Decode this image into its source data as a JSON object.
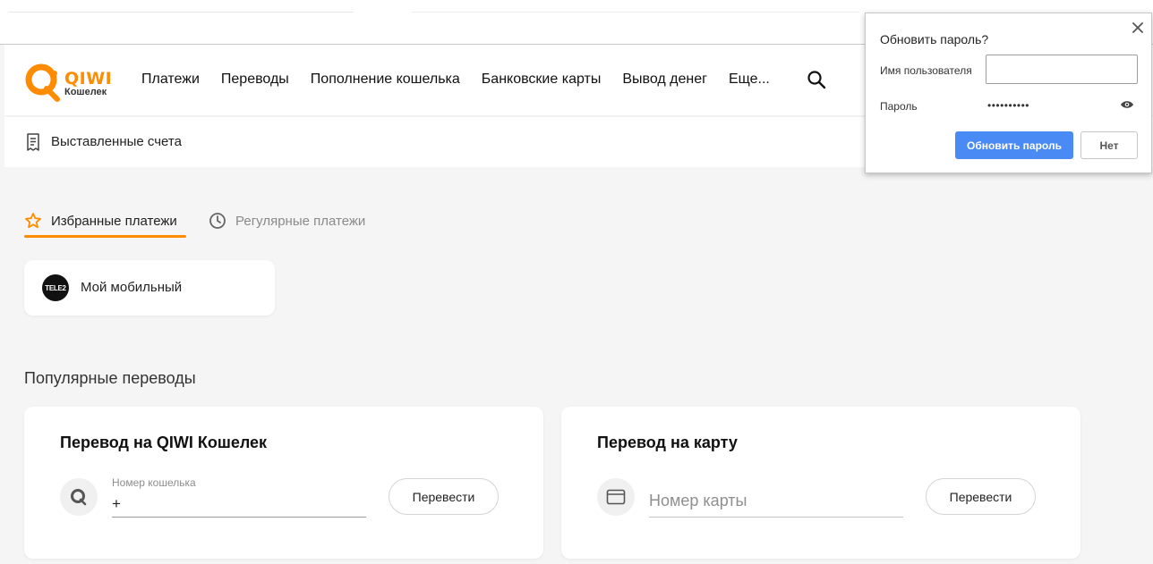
{
  "brand": {
    "name": "QIWI",
    "sub": "Кошелек",
    "accent": "#ff8c00"
  },
  "nav": {
    "items": [
      "Платежи",
      "Переводы",
      "Пополнение кошелька",
      "Банковские карты",
      "Вывод денег",
      "Еще..."
    ],
    "search_icon": "search-icon"
  },
  "subbar": {
    "label": "Выставленные счета",
    "icon": "receipt-icon"
  },
  "tabs": [
    {
      "label": "Избранные платежи",
      "icon": "star-icon",
      "active": true
    },
    {
      "label": "Регулярные платежи",
      "icon": "clock-icon",
      "active": false
    }
  ],
  "favorites": [
    {
      "label": "Мой мобильный",
      "logo_text": "TELE2"
    }
  ],
  "popular": {
    "title": "Популярные переводы",
    "cards": [
      {
        "title": "Перевод на QIWI Кошелек",
        "field_label": "Номер кошелька",
        "field_value": "+",
        "button": "Перевести",
        "icon": "qiwi-icon"
      },
      {
        "title": "Перевод на карту",
        "field_placeholder": "Номер карты",
        "button": "Перевести",
        "icon": "card-icon"
      }
    ]
  },
  "password_popup": {
    "title": "Обновить пароль?",
    "username_label": "Имя пользователя",
    "username_value": "",
    "password_label": "Пароль",
    "password_value": "••••••••••",
    "update_button": "Обновить пароль",
    "no_button": "Нет",
    "accent": "#4a8af4"
  }
}
